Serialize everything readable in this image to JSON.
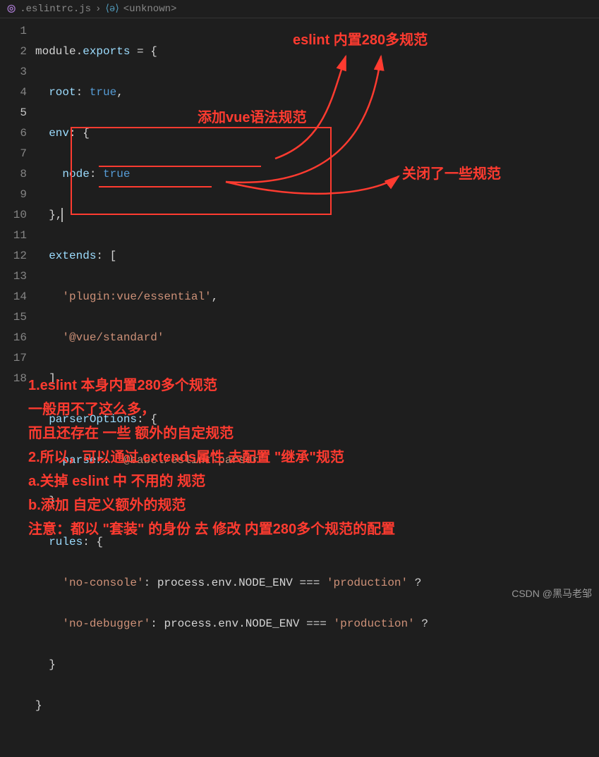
{
  "breadcrumb": {
    "file": ".eslintrc.js",
    "symbol": "<unknown>",
    "sep": "›"
  },
  "gutter": [
    "1",
    "2",
    "3",
    "4",
    "5",
    "6",
    "7",
    "8",
    "9",
    "10",
    "11",
    "12",
    "13",
    "14",
    "15",
    "16",
    "17",
    "18"
  ],
  "activeLine": "5",
  "code": {
    "l1a": "module",
    "l1b": ".",
    "l1c": "exports",
    "l1d": " = {",
    "l2a": "  root",
    "l2b": ": ",
    "l2c": "true",
    "l2d": ",",
    "l3a": "  env",
    "l3b": ": {",
    "l4a": "    node",
    "l4b": ": ",
    "l4c": "true",
    "l5a": "  },",
    "l6a": "  extends",
    "l6b": ": [",
    "l7a": "    ",
    "l7b": "'plugin:vue/essential'",
    "l7c": ",",
    "l8a": "    ",
    "l8b": "'@vue/standard'",
    "l9a": "  ],",
    "l10a": "  parserOptions",
    "l10b": ": {",
    "l11a": "    parser",
    "l11b": ": ",
    "l11c": "'@babel/eslint-parser'",
    "l12a": "  },",
    "l13a": "  rules",
    "l13b": ": {",
    "l14a": "    ",
    "l14b": "'no-console'",
    "l14c": ": ",
    "l14d": "process",
    "l14e": ".",
    "l14f": "env",
    "l14g": ".",
    "l14h": "NODE_ENV",
    "l14i": " === ",
    "l14j": "'production'",
    "l14k": " ?",
    "l15a": "    ",
    "l15b": "'no-debugger'",
    "l15c": ": ",
    "l15d": "process",
    "l15e": ".",
    "l15f": "env",
    "l15g": ".",
    "l15h": "NODE_ENV",
    "l15i": " === ",
    "l15j": "'production'",
    "l15k": " ?",
    "l16a": "  }",
    "l17a": "}"
  },
  "annotations": {
    "top1": "eslint 内置280多规范",
    "top2": "添加vue语法规范",
    "top3": "关闭了一些规范",
    "n1": "1.eslint 本身内置280多个规范",
    "n2": "   一般用不了这么多，",
    "n3": "   而且还存在 一些 额外的自定规范",
    "n4": "2.所以，可以通过 extends属性 去配置 \"继承\"规范",
    "n5": "   a.关掉 eslint 中 不用的 规范",
    "n6": "   b.添加 自定义额外的规范",
    "n7": "   注意：都以 \"套装\" 的身份 去 修改 内置280多个规范的配置"
  },
  "watermark": "CSDN @黑马老邹"
}
